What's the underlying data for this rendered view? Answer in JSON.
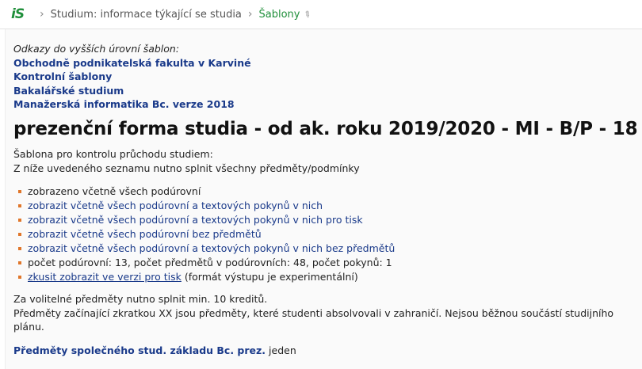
{
  "breadcrumb": {
    "logo": "iS",
    "items": [
      "Studium: informace týkající se studia",
      "Šablony"
    ]
  },
  "upper_templates": {
    "title": "Odkazy do vyšších úrovní šablon:",
    "links": [
      "Obchodně podnikatelská fakulta v Karviné",
      "Kontrolní šablony",
      "Bakalářské studium",
      "Manažerská informatika Bc. verze 2018"
    ]
  },
  "page_title": "prezenční forma studia - od ak. roku 2019/2020 - MI - B/P - 18",
  "description": [
    "Šablona pro kontrolu průchodu studiem:",
    "Z níže uvedeného seznamu nutno splnit všechny předměty/podmínky"
  ],
  "options": {
    "shown": "zobrazeno včetně všech podúrovní",
    "links": [
      "zobrazit včetně všech podúrovní a textových pokynů v nich",
      "zobrazit včetně všech podúrovní a textových pokynů v nich pro tisk",
      "zobrazit včetně všech podúrovní bez předmětů",
      "zobrazit včetně všech podúrovní a textových pokynů v nich bez předmětů"
    ],
    "counts": "počet podúrovní: 13, počet předmětů v podúrovních: 48, počet pokynů: 1",
    "print_link": "zkusit zobrazit ve verzi pro tisk",
    "print_note": " (formát výstupu je experimentální)"
  },
  "notes": [
    "Za volitelné předměty nutno splnit min. 10 kreditů.",
    "Předměty začínající zkratkou XX jsou předměty, které studenti absolvovali v zahraničí. Nejsou běžnou součástí studijního plánu."
  ],
  "footer": {
    "link": "Předměty společného stud. základu Bc. prez.",
    "suffix": " jeden"
  }
}
